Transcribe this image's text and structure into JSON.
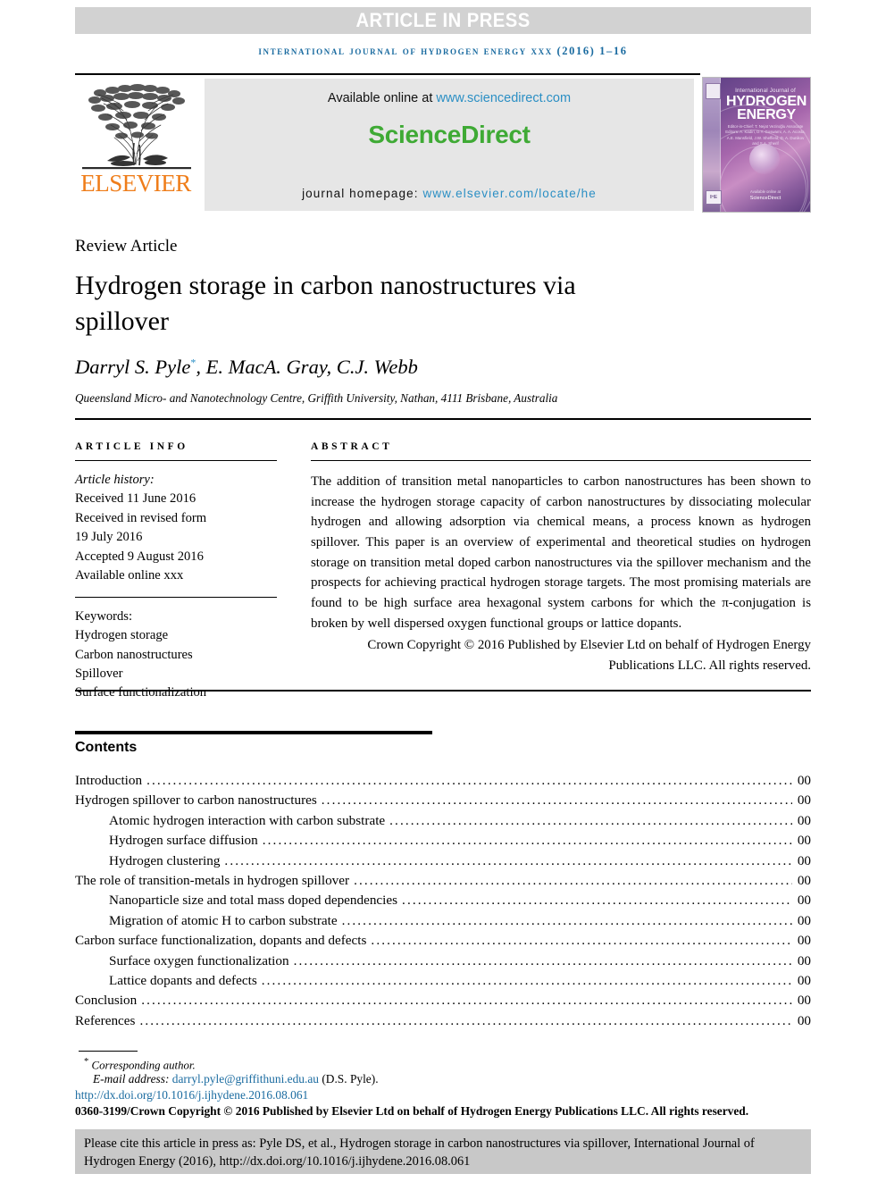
{
  "banner": {
    "text": "ARTICLE IN PRESS"
  },
  "running_head": {
    "text": "International Journal of Hydrogen Energy xxx (2016) 1–16"
  },
  "masthead": {
    "publisher_logo_text": "ELSEVIER",
    "available_prefix": "Available online at ",
    "available_link": "www.sciencedirect.com",
    "sciencedirect_logo": "ScienceDirect",
    "homepage_prefix": "journal homepage: ",
    "homepage_link": "www.elsevier.com/locate/he",
    "cover": {
      "line_small": "International Journal of",
      "line_1": "HYDROGEN",
      "line_2": "ENERGY",
      "editors": "Editor-in-Chief: T. Nejat Veziroğlu\nAssociate Editors: A. Kadiri, D.Y. Goswami, A. A. Acosta, A.E. Mansfield, J.W. Sheffield, D. A. Dunikov and S.A. Sherif",
      "sciencedirect_mark": "ScienceDirect",
      "sciencedirect_tiny": "Available online at",
      "ihe_mark": "IHE"
    }
  },
  "article": {
    "type": "Review Article",
    "title": "Hydrogen storage in carbon nanostructures via spillover",
    "authors": "Darryl S. Pyle",
    "authors_rest": ", E. MacA. Gray, C.J. Webb",
    "corresponding_marker": "*",
    "affiliation": "Queensland Micro- and Nanotechnology Centre, Griffith University, Nathan, 4111 Brisbane, Australia"
  },
  "article_info": {
    "heading": "ARTICLE INFO",
    "history_label": "Article history:",
    "history": [
      "Received 11 June 2016",
      "Received in revised form",
      "19 July 2016",
      "Accepted 9 August 2016",
      "Available online xxx"
    ],
    "keywords_label": "Keywords:",
    "keywords": [
      "Hydrogen storage",
      "Carbon nanostructures",
      "Spillover",
      "Surface functionalization"
    ]
  },
  "abstract": {
    "heading": "ABSTRACT",
    "body": "The addition of transition metal nanoparticles to carbon nanostructures has been shown to increase the hydrogen storage capacity of carbon nanostructures by dissociating molecular hydrogen and allowing adsorption via chemical means, a process known as hydrogen spillover. This paper is an overview of experimental and theoretical studies on hydrogen storage on transition metal doped carbon nanostructures via the spillover mechanism and the prospects for achieving practical hydrogen storage targets. The most promising materials are found to be high surface area hexagonal system carbons for which the π-conjugation is broken by well dispersed oxygen functional groups or lattice dopants.",
    "copyright": "Crown Copyright © 2016 Published by Elsevier Ltd on behalf of Hydrogen Energy Publications LLC. All rights reserved."
  },
  "contents": {
    "heading": "Contents",
    "entries": [
      {
        "label": "Introduction",
        "page": "00",
        "level": 1
      },
      {
        "label": "Hydrogen spillover to carbon nanostructures",
        "page": "00",
        "level": 1
      },
      {
        "label": "Atomic hydrogen interaction with carbon substrate",
        "page": "00",
        "level": 2
      },
      {
        "label": "Hydrogen surface diffusion",
        "page": "00",
        "level": 2
      },
      {
        "label": "Hydrogen clustering",
        "page": "00",
        "level": 2
      },
      {
        "label": "The role of transition-metals in hydrogen spillover",
        "page": "00",
        "level": 1
      },
      {
        "label": "Nanoparticle size and total mass doped dependencies",
        "page": "00",
        "level": 2
      },
      {
        "label": "Migration of atomic H to carbon substrate",
        "page": "00",
        "level": 2
      },
      {
        "label": "Carbon surface functionalization, dopants and defects",
        "page": "00",
        "level": 1
      },
      {
        "label": "Surface oxygen functionalization",
        "page": "00",
        "level": 2
      },
      {
        "label": "Lattice dopants and defects",
        "page": "00",
        "level": 2
      },
      {
        "label": "Conclusion",
        "page": "00",
        "level": 1
      },
      {
        "label": "References",
        "page": "00",
        "level": 1
      }
    ]
  },
  "footnotes": {
    "corresponding": "Corresponding author.",
    "corresponding_marker": "*",
    "email_label": "E-mail address:",
    "email": "darryl.pyle@griffithuni.edu.au",
    "email_person": "(D.S. Pyle).",
    "doi": "http://dx.doi.org/10.1016/j.ijhydene.2016.08.061",
    "copyright_line": "0360-3199/Crown Copyright © 2016 Published by Elsevier Ltd on behalf of Hydrogen Energy Publications LLC. All rights reserved."
  },
  "cite_box": {
    "text": "Please cite this article in press as: Pyle DS, et al., Hydrogen storage in carbon nanostructures via spillover, International Journal of Hydrogen Energy (2016), http://dx.doi.org/10.1016/j.ijhydene.2016.08.061"
  },
  "colors": {
    "banner_bg": "#d2d2d2",
    "link_blue": "#2b8fc4",
    "running_head_blue": "#1a6ba0",
    "sciencedirect_green": "#3faa35",
    "elsevier_orange": "#ef7d1a",
    "cite_box_bg": "#c8c8c8"
  }
}
